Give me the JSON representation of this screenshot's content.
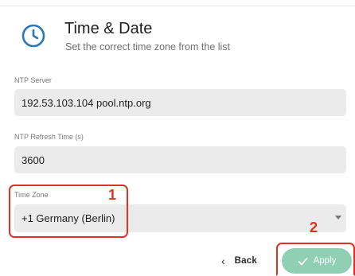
{
  "header": {
    "icon": "clock-icon",
    "title": "Time & Date",
    "subtitle": "Set the correct time zone from the list"
  },
  "fields": {
    "ntp_server": {
      "label": "NTP Server",
      "value": "192.53.103.104 pool.ntp.org"
    },
    "ntp_refresh": {
      "label": "NTP Refresh Time (s)",
      "value": "3600"
    },
    "time_zone": {
      "label": "Time Zone",
      "value": "+1 Germany (Berlin)",
      "icon": "dropdown-arrow-icon"
    }
  },
  "annotations": {
    "step1": "1",
    "step2": "2",
    "color": "#e0321e"
  },
  "actions": {
    "back_label": "Back",
    "back_icon": "chevron-left-icon",
    "apply_label": "Apply",
    "apply_icon": "check-icon"
  },
  "colors": {
    "accent": "#2a78b8",
    "apply_bg": "#8fd0b4",
    "field_bg": "#ebebeb"
  }
}
